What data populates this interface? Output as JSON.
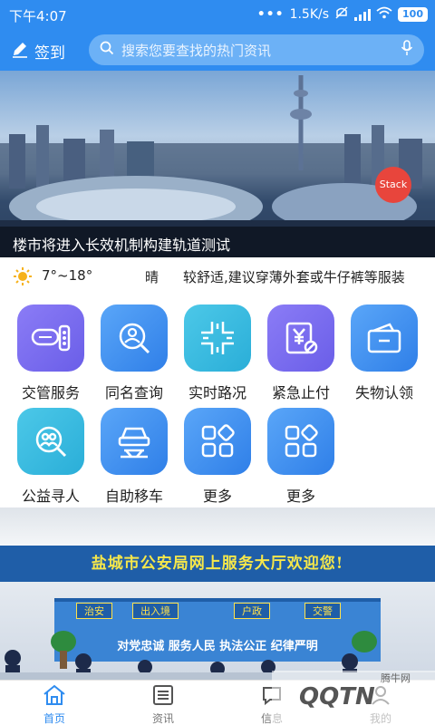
{
  "status_bar": {
    "time": "下午4:07",
    "dots": "•••",
    "network_speed": "1.5K/s",
    "battery": "100"
  },
  "header": {
    "signin_label": "签到",
    "search_placeholder": "搜索您要查找的热门资讯"
  },
  "banner": {
    "caption": "楼市将进入长效机制构建轨道测试",
    "badge": "Stack"
  },
  "weather": {
    "temperature": "7°~18°",
    "condition": "晴",
    "tip": "较舒适,建议穿薄外套或牛仔裤等服装"
  },
  "services": [
    {
      "label": "交管服务",
      "icon": "traffic-light-icon"
    },
    {
      "label": "同名查询",
      "icon": "person-search-icon"
    },
    {
      "label": "实时路况",
      "icon": "crossroad-icon"
    },
    {
      "label": "紧急止付",
      "icon": "payment-stop-icon"
    },
    {
      "label": "失物认领",
      "icon": "wallet-icon"
    },
    {
      "label": "公益寻人",
      "icon": "find-person-icon"
    },
    {
      "label": "自助移车",
      "icon": "car-lift-icon"
    },
    {
      "label": "更多",
      "icon": "grid-icon"
    },
    {
      "label": "更多",
      "icon": "grid-icon"
    }
  ],
  "hall": {
    "sign": "盐城市公安局网上服务大厅欢迎您!",
    "tabs": [
      "治安",
      "出入境",
      "户政",
      "交警"
    ],
    "slogan": "对党忠诚  服务人民  执法公正  纪律严明"
  },
  "bottom_nav": [
    {
      "label": "首页",
      "icon": "home-icon",
      "active": true
    },
    {
      "label": "资讯",
      "icon": "news-icon",
      "active": false
    },
    {
      "label": "信息",
      "icon": "message-icon",
      "active": false
    },
    {
      "label": "我的",
      "icon": "user-icon",
      "active": false
    }
  ],
  "watermark": {
    "logo": "QQTN",
    "text": "腾牛网"
  },
  "colors": {
    "primary": "#2f8cf0",
    "search_bg": "#6cb1f6",
    "icon_blue": "#3d8ff0",
    "icon_purple": "#7a6cf0",
    "icon_cyan": "#33bde0"
  }
}
